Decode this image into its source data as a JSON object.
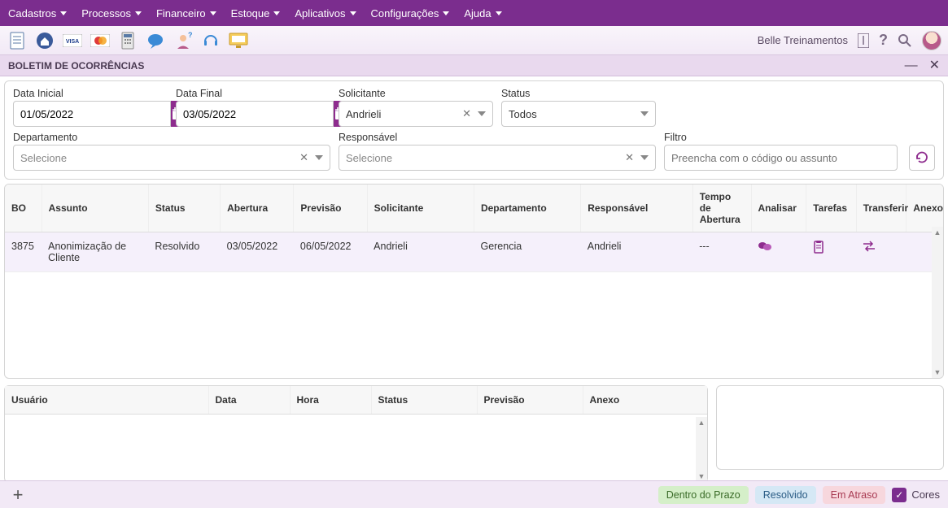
{
  "menubar": {
    "items": [
      "Cadastros",
      "Processos",
      "Financeiro",
      "Estoque",
      "Aplicativos",
      "Configurações",
      "Ajuda"
    ]
  },
  "toolbar": {
    "company_name": "Belle Treinamentos"
  },
  "panel": {
    "title": "BOLETIM DE OCORRÊNCIAS"
  },
  "filters": {
    "data_inicial_label": "Data Inicial",
    "data_inicial_value": "01/05/2022",
    "data_final_label": "Data Final",
    "data_final_value": "03/05/2022",
    "solicitante_label": "Solicitante",
    "solicitante_value": "Andrieli",
    "status_label": "Status",
    "status_value": "Todos",
    "departamento_label": "Departamento",
    "departamento_value": "Selecione",
    "responsavel_label": "Responsável",
    "responsavel_value": "Selecione",
    "filtro_label": "Filtro",
    "filtro_placeholder": "Preencha com o código ou assunto"
  },
  "main_table": {
    "headers": [
      "BO",
      "Assunto",
      "Status",
      "Abertura",
      "Previsão",
      "Solicitante",
      "Departamento",
      "Responsável",
      "Tempo de Abertura",
      "Analisar",
      "Tarefas",
      "Transferir",
      "Anexo"
    ],
    "rows": [
      {
        "bo": "3875",
        "assunto": "Anonimização de Cliente",
        "status": "Resolvido",
        "abertura": "03/05/2022",
        "previsao": "06/05/2022",
        "solicitante": "Andrieli",
        "departamento": "Gerencia",
        "responsavel": "Andrieli",
        "tempo": "---"
      }
    ]
  },
  "lower_table": {
    "headers": [
      "Usuário",
      "Data",
      "Hora",
      "Status",
      "Previsão",
      "Anexo"
    ]
  },
  "footer": {
    "dentro_prazo": "Dentro do Prazo",
    "resolvido": "Resolvido",
    "em_atraso": "Em Atraso",
    "cores": "Cores"
  }
}
